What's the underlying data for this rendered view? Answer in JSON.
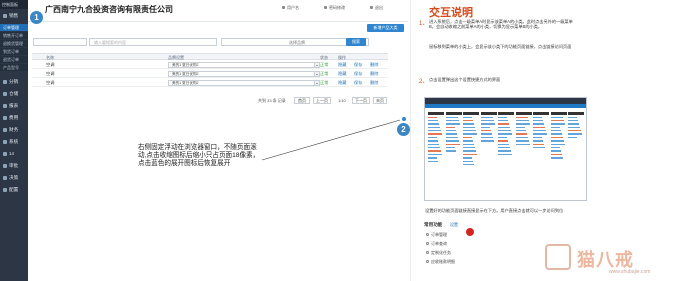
{
  "app": {
    "brand": "控制面板",
    "company": "广西南宁九合投资咨询有限责任公司"
  },
  "topbar": {
    "user_menu": [
      "用户名",
      "密码修改",
      "退出"
    ]
  },
  "sidebar": {
    "items": [
      {
        "label": "销售"
      },
      {
        "label": "订单管理",
        "active": true
      },
      {
        "label": "销售开订单"
      },
      {
        "label": "退换货管理"
      },
      {
        "label": "到货订单"
      },
      {
        "label": "退货订单"
      },
      {
        "label": "产品型号"
      },
      {
        "label": "分销"
      },
      {
        "label": "仓储"
      },
      {
        "label": "报表"
      },
      {
        "label": "费用"
      },
      {
        "label": "财务"
      },
      {
        "label": "系统"
      },
      {
        "label": "14"
      },
      {
        "label": "审批"
      },
      {
        "label": "决策"
      },
      {
        "label": "配置"
      }
    ]
  },
  "flyout": {
    "items": [
      "订单管理",
      "订单查询",
      "订单管理设置"
    ]
  },
  "main": {
    "add_button": "新增产品大类",
    "search": {
      "placeholder": "输入要搜索的内容",
      "field_label": "选择品牌",
      "button": "搜索"
    },
    "table": {
      "headers": [
        "名称",
        "品牌设置",
        "状态",
        "操作"
      ],
      "rows": [
        {
          "name": "空调",
          "brand": "美的1 夏日优购2",
          "status": "正常",
          "action1": "隐藏",
          "action2": "保存",
          "action3": "删除"
        },
        {
          "name": "空调",
          "brand": "美的1 夏日优购2",
          "status": "正常",
          "action1": "隐藏",
          "action2": "保存",
          "action3": "删除"
        },
        {
          "name": "空调",
          "brand": "美的1 夏日优购2",
          "status": "正常",
          "action1": "隐藏",
          "action2": "保存",
          "action3": "删除"
        }
      ]
    },
    "pager": {
      "summary": "共到 33 条 记录",
      "first": "首页",
      "prev": "上一页",
      "page": "1/10",
      "next": "下一页",
      "last": "末页"
    }
  },
  "callout": "右侧固定浮动在浏览器窗口，不随页面滚动,点击收缩图标后缩小只占页面18像素，点击蓝色的展开图标后恢复展开",
  "badges": {
    "one": "1",
    "two": "2"
  },
  "right_panel": {
    "title": "交互说明",
    "step1_num": "1、",
    "step1_text": "进入系统后，点击一级菜单A时显示该菜单A的小类。此时点击另外的一级菜单B，会自动收缩之前菜单A的小类，切换为显示菜单B的小类。",
    "step1_text2": "鼠标移到菜单的小类上，会显示该小类下的功能页面链接，点击链接访问页面",
    "step2_num": "2、",
    "step2_text": "点击设置弹出这个设置快捷方式的界面",
    "fav_note": "设置好的功能页面链接直接显示在下方。用户直接点击就可以一步访问到位",
    "favorites": {
      "title": "常用功能",
      "set": "设置",
      "items": [
        "订单管理",
        "订单查询",
        "定制化任务",
        "应收账款明细"
      ]
    }
  },
  "watermark": {
    "text": "猫八戒",
    "url": "www.shubajie.com"
  },
  "colors": {
    "nav_bg": "#2c3644",
    "accent": "#1d79c4",
    "callout_red": "#d74a1a",
    "status_green": "#3aa33a"
  }
}
